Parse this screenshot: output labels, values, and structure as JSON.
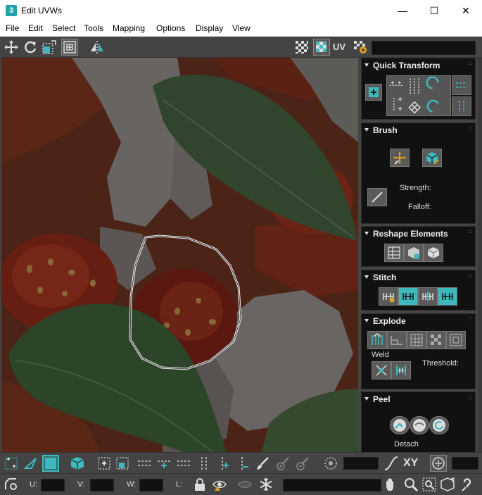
{
  "window": {
    "title": "Edit UVWs",
    "app_icon": "3",
    "controls": {
      "minimize": "—",
      "maximize": "☐",
      "close": "✕"
    }
  },
  "menubar": [
    "File",
    "Edit",
    "Select",
    "Tools",
    "Mapping",
    "Options",
    "Display",
    "View"
  ],
  "toolbar": {
    "left_icons": [
      "move-icon",
      "rotate-icon",
      "scale-icon",
      "freeform-icon",
      "mirror-icon"
    ],
    "right_icons": [
      "checker-toggle-icon",
      "checker-map-icon",
      "uv-settings-icon"
    ],
    "uv_label": "UV"
  },
  "panel": {
    "quick_transform": {
      "title": "Quick Transform"
    },
    "brush": {
      "title": "Brush",
      "strength_label": "Strength:",
      "falloff_label": "Falloff:"
    },
    "reshape": {
      "title": "Reshape Elements"
    },
    "stitch": {
      "title": "Stitch"
    },
    "explode": {
      "title": "Explode",
      "weld_label": "Weld",
      "threshold_label": "Threshold:"
    },
    "peel": {
      "title": "Peel",
      "detach_label": "Detach"
    }
  },
  "bottom1": {
    "xy_label": "XY"
  },
  "bottom2": {
    "u_label": "U:",
    "v_label": "V:",
    "w_label": "W:",
    "l_label": "L:"
  },
  "colors": {
    "accent": "#3fb9bd",
    "panel_bg": "#111111",
    "ui_bg": "#444444"
  }
}
